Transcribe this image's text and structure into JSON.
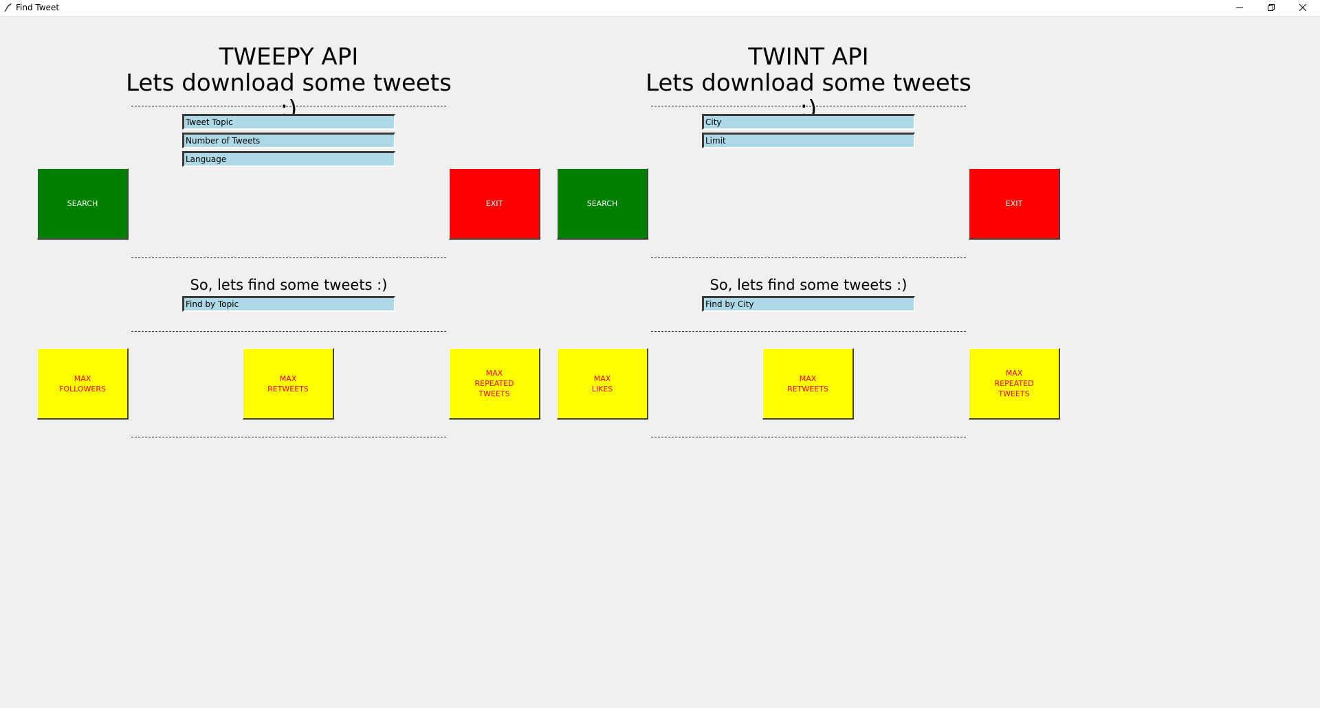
{
  "window": {
    "title": "Find Tweet",
    "icon": "feather-icon",
    "controls": [
      "minimize-icon",
      "restore-icon",
      "close-icon"
    ]
  },
  "colors": {
    "background": "#f0f0f0",
    "entry_bg": "#add8e6",
    "search_button": "#008000",
    "exit_button": "#ff0000",
    "stat_button": "#ffff00",
    "stat_button_text": "#ff0000"
  },
  "tweepy": {
    "title": "TWEEPY API",
    "subtitle": "Lets download some tweets :)",
    "fields": {
      "topic": "Tweet Topic",
      "count": "Number of Tweets",
      "language": "Language"
    },
    "search_label": "SEARCH",
    "exit_label": "EXIT",
    "find_heading": "So, lets find some tweets :)",
    "find_field": "Find by Topic",
    "stats": {
      "followers": "MAX\nFOLLOWERS",
      "retweets": "MAX\nRETWEETS",
      "repeated": "MAX\nREPEATED\nTWEETS"
    }
  },
  "twint": {
    "title": "TWINT API",
    "subtitle": "Lets download some tweets :)",
    "fields": {
      "city": "City",
      "limit": "Limit"
    },
    "search_label": "SEARCH",
    "exit_label": "EXIT",
    "find_heading": "So, lets find some tweets :)",
    "find_field": "Find by City",
    "stats": {
      "likes": "MAX\nLIKES",
      "retweets": "MAX\nRETWEETS",
      "repeated": "MAX\nREPEATED\nTWEETS"
    }
  }
}
